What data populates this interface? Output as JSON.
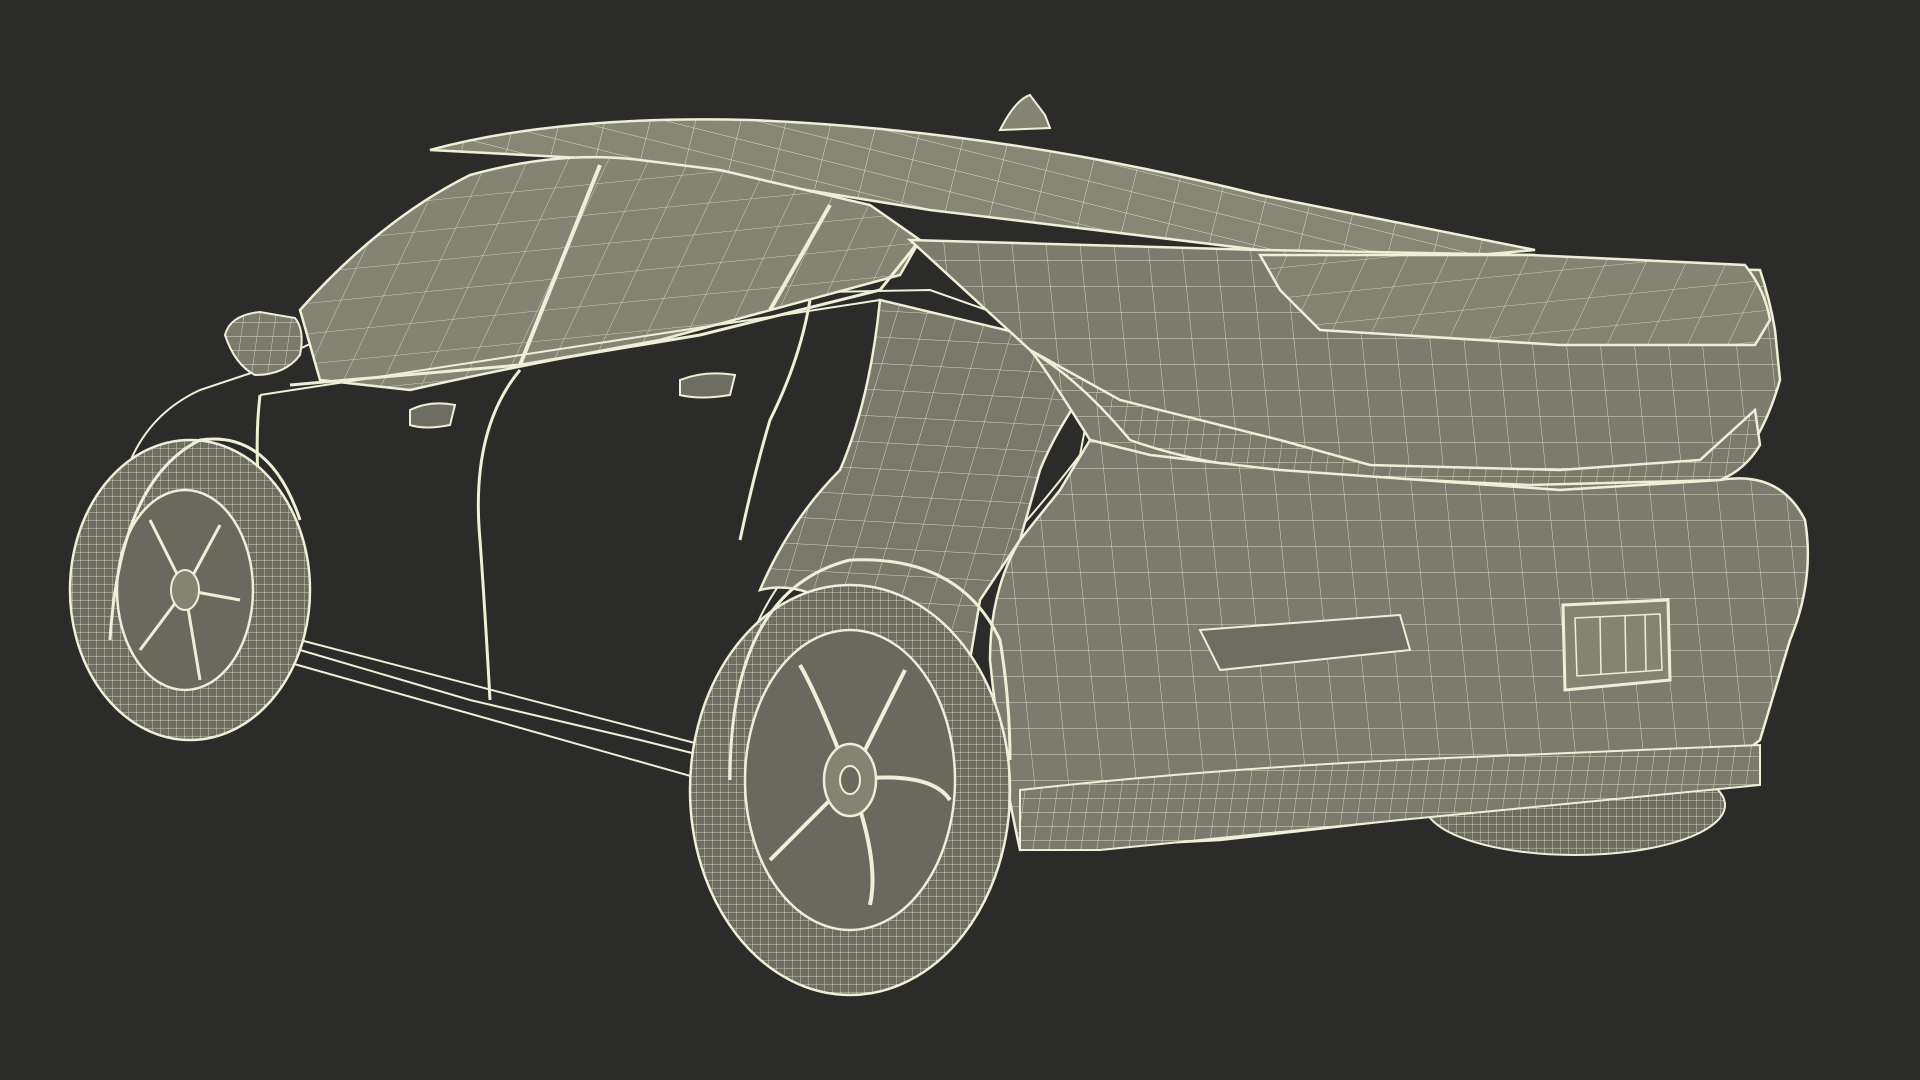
{
  "scene": {
    "subject": "car-wireframe-render",
    "colors": {
      "background": "#2b2b2a",
      "surface": "#7b7a6c",
      "surface_dark": "#5f5e53",
      "glass": "#858474",
      "wire": "#efefd8",
      "tire": "#6e6d62"
    }
  }
}
